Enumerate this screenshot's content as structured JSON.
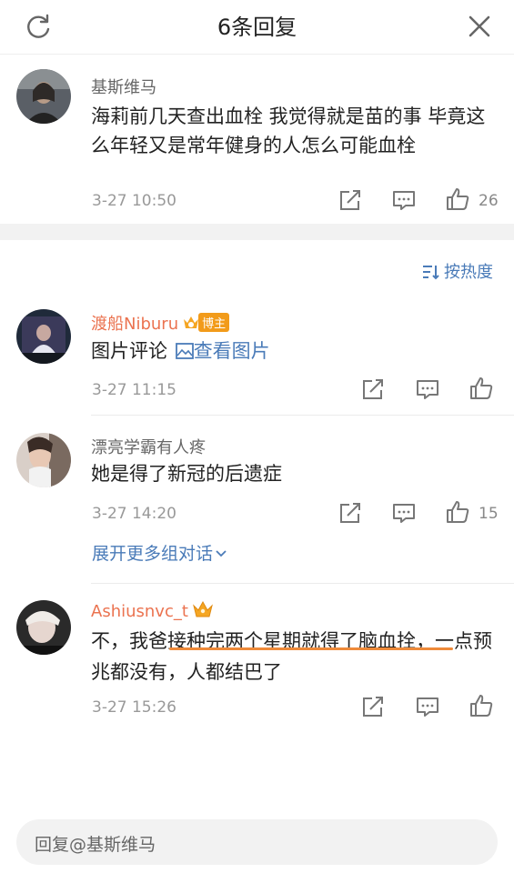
{
  "header": {
    "title": "6条回复"
  },
  "root_comment": {
    "username": "基斯维马",
    "text": "海莉前几天查出血栓 我觉得就是苗的事 毕竟这么年轻又是常年健身的人怎么可能血栓",
    "time": "3-27 10:50",
    "likes": "26"
  },
  "sort": {
    "label": "按热度"
  },
  "replies": [
    {
      "username": "渡船Niburu",
      "badge": "博主",
      "text_prefix": "图片评论",
      "link_text": "查看图片",
      "time": "3-27 11:15",
      "likes": ""
    },
    {
      "username": "漂亮学霸有人疼",
      "text": "她是得了新冠的后遗症",
      "time": "3-27 14:20",
      "likes": "15",
      "more_link": "展开更多组对话"
    },
    {
      "username": "Ashiusnvc_t",
      "text": "不，我爸接种完两个星期就得了脑血拴，一点预兆都没有，人都结巴了",
      "time": "3-27 15:26",
      "likes": ""
    }
  ],
  "reply_box": {
    "placeholder": "回复@基斯维马"
  },
  "colors": {
    "link": "#4a7bb8",
    "username_highlight": "#eb7350",
    "underline": "#ee8a3a",
    "badge": "#f29b1a"
  }
}
